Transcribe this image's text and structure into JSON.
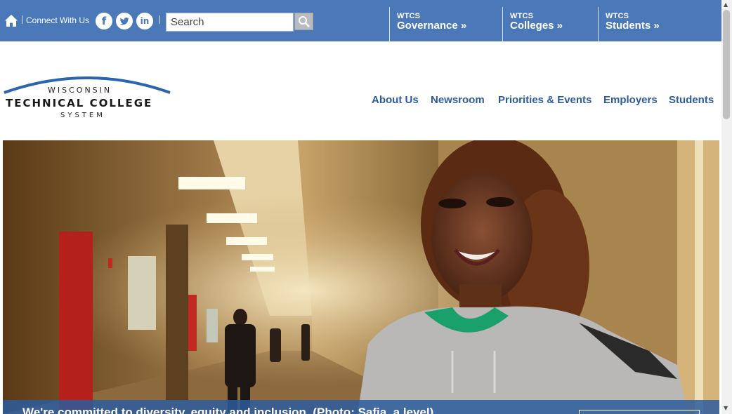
{
  "topbar": {
    "connect_label": "Connect With Us",
    "social": [
      {
        "name": "facebook",
        "glyph": "f"
      },
      {
        "name": "twitter",
        "glyph": "t"
      },
      {
        "name": "linkedin",
        "glyph": "in"
      }
    ],
    "search_placeholder": "Search",
    "wtcs_links": [
      {
        "small": "WTCS",
        "label": "Governance »"
      },
      {
        "small": "WTCS",
        "label": "Colleges »"
      },
      {
        "small": "WTCS",
        "label": "Students »"
      }
    ]
  },
  "logo": {
    "line1": "WISCONSIN",
    "line2": "TECHNICAL COLLEGE",
    "line3": "SYSTEM"
  },
  "nav": {
    "items": [
      "About Us",
      "Newsroom",
      "Priorities & Events",
      "Employers",
      "Students"
    ]
  },
  "hero": {
    "caption": "We're committed to diversity, equity and inclusion. (Photo: Safia, a level)"
  },
  "colors": {
    "topbar_bg": "#4a78b9",
    "nav_text": "#2c5c9e",
    "logo_arc": "#2a64b0"
  }
}
